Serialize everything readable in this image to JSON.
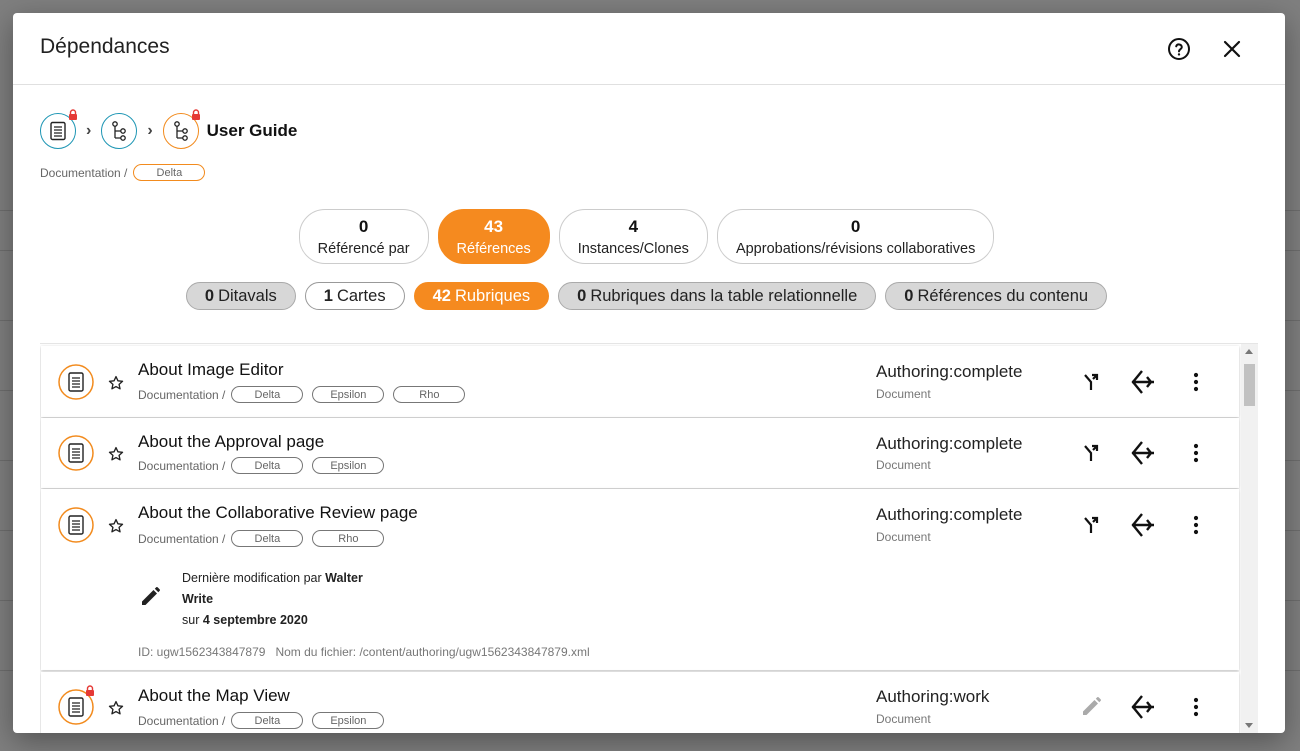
{
  "dialog": {
    "title": "Dépendances",
    "breadcrumb_title": "User Guide",
    "breadcrumb_path": "Documentation /",
    "breadcrumb_tag": "Delta"
  },
  "stats": [
    {
      "num": "0",
      "label": "Référencé par",
      "active": false
    },
    {
      "num": "43",
      "label": "Références",
      "active": true
    },
    {
      "num": "4",
      "label": "Instances/Clones",
      "active": false
    },
    {
      "num": "0",
      "label": "Approbations/révisions collaboratives",
      "active": false
    }
  ],
  "chips": [
    {
      "count": "0",
      "label": "Ditavals",
      "style": "grey"
    },
    {
      "count": "1",
      "label": "Cartes",
      "style": "white"
    },
    {
      "count": "42",
      "label": "Rubriques",
      "style": "active"
    },
    {
      "count": "0",
      "label": "Rubriques dans la table relationnelle",
      "style": "grey"
    },
    {
      "count": "0",
      "label": "Références du contenu",
      "style": "grey"
    }
  ],
  "items": [
    {
      "title": "About Image Editor",
      "path": "Documentation /",
      "tags": [
        "Delta",
        "Epsilon",
        "Rho"
      ],
      "status": "Authoring:complete",
      "type": "Document"
    },
    {
      "title": "About the Approval page",
      "path": "Documentation /",
      "tags": [
        "Delta",
        "Epsilon"
      ],
      "status": "Authoring:complete",
      "type": "Document"
    },
    {
      "title": "About the Collaborative Review page",
      "path": "Documentation /",
      "tags": [
        "Delta",
        "Rho"
      ],
      "status": "Authoring:complete",
      "type": "Document",
      "details": {
        "modified_prefix": "Dernière modification par",
        "user": "Walter",
        "user2": "Write",
        "on": "sur",
        "date": "4 septembre 2020",
        "id_line": "ID: ugw1562343847879   Nom du fichier: /content/authoring/ugw1562343847879.xml"
      }
    },
    {
      "title": "About the Map View",
      "path": "Documentation /",
      "tags": [
        "Delta",
        "Epsilon"
      ],
      "status": "Authoring:work",
      "type": "Document"
    }
  ],
  "icons": {
    "help": "help-circle-icon",
    "close": "close-icon",
    "star": "star-outline-icon",
    "branch": "branch-icon",
    "dependencies": "dependencies-icon",
    "more": "more-vert-icon",
    "edit": "pencil-icon"
  },
  "colors": {
    "accent": "#f58a1f",
    "teal": "#1e96b4",
    "lock": "#e53935"
  }
}
